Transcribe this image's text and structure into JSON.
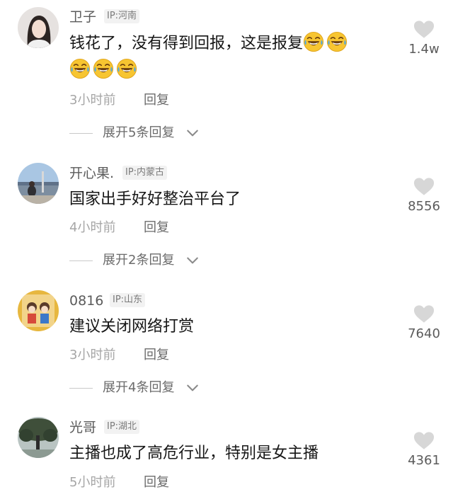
{
  "comments": [
    {
      "author": "卫子",
      "ip": "IP:河南",
      "text": "钱花了，没有得到回报，这是报复",
      "emojis": [
        "grin-sweat-emoji",
        "grin-sweat-emoji",
        "grin-sweat-emoji",
        "grin-sweat-emoji",
        "grin-sweat-emoji"
      ],
      "time": "3小时前",
      "reply": "回复",
      "expand": "展开5条回复",
      "likes": "1.4w"
    },
    {
      "author": "开心果.",
      "ip": "IP:内蒙古",
      "text": "国家出手好好整治平台了",
      "time": "4小时前",
      "reply": "回复",
      "expand": "展开2条回复",
      "likes": "8556"
    },
    {
      "author": "0816",
      "ip": "IP:山东",
      "text": "建议关闭网络打赏",
      "time": "3小时前",
      "reply": "回复",
      "expand": "展开4条回复",
      "likes": "7640"
    },
    {
      "author": "光哥",
      "ip": "IP:湖北",
      "text": "主播也成了高危行业，特别是女主播",
      "time": "5小时前",
      "reply": "回复",
      "likes": "4361"
    }
  ],
  "icons": {
    "like": "heart-icon",
    "expand": "chevron-down-icon"
  },
  "colors": {
    "heart": "#d7d7d7",
    "secondary_text": "#a6a6a6",
    "emoji_yellow": "#f7c531"
  }
}
